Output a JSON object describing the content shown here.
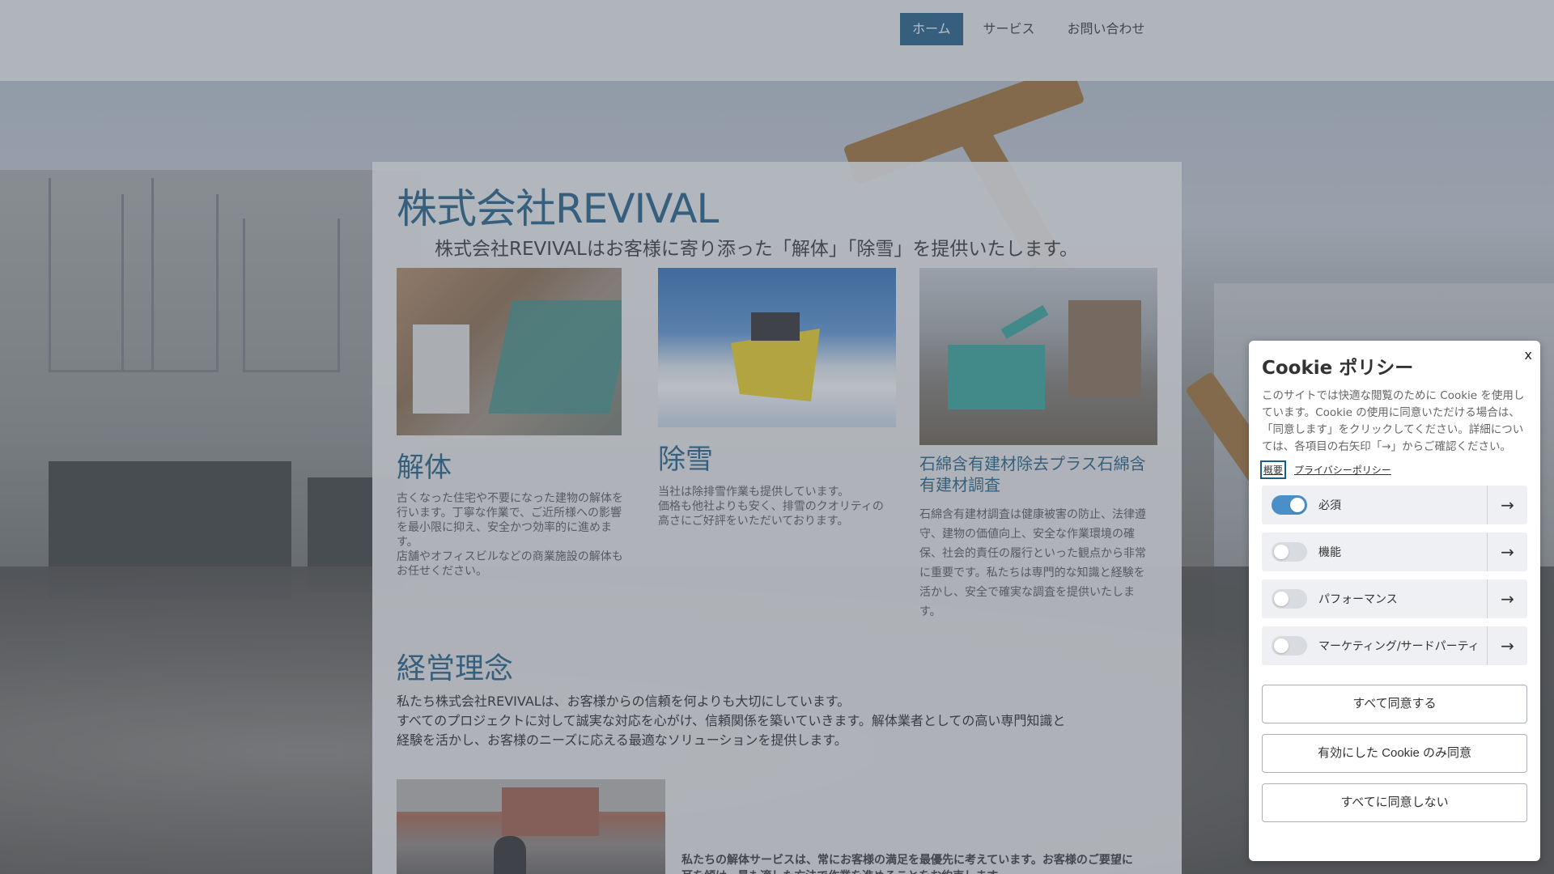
{
  "nav": {
    "items": [
      {
        "label": "ホーム",
        "active": true
      },
      {
        "label": "サービス",
        "active": false
      },
      {
        "label": "お問い合わせ",
        "active": false
      }
    ]
  },
  "hero": {
    "title": "株式会社REVIVAL",
    "lead": "株式会社REVIVALはお客様に寄り添った「解体」「除雪」を提供いたします。"
  },
  "services": [
    {
      "title": "解体",
      "text_lines": [
        " 古くなった住宅や不要になった建物の解体を",
        "行います。丁寧な作業で、ご近所様への影響",
        "を最小限に抑え、安全かつ効率的に進めま",
        "す。",
        "店舗やオフィスビルなどの商業施設の解体も",
        "お任せください。"
      ]
    },
    {
      "title": "除雪",
      "text_lines": [
        "当社は除排雪作業も提供しています。",
        "価格も他社よりも安く、排雪のクオリティの",
        "高さにご好評をいただいております。"
      ]
    },
    {
      "title": "石綿含有建材除去プラス石綿含有建材調査",
      "text_lines": [
        "石綿含有建材調査は健康被害の防止、法律遵",
        "守、建物の価値向上、安全な作業環境の確",
        "保、社会的責任の履行といった観点から非常",
        "に重要です。私たちは専門的な知識と経験を",
        "活かし、安全で確実な調査を提供いたしま",
        "す。"
      ]
    }
  ],
  "philosophy": {
    "title": "経営理念",
    "lines": [
      "私たち株式会社REVIVALは、お客様からの信頼を何よりも大切にしています。",
      "すべてのプロジェクトに対して誠実な対応を心がけ、信頼関係を築いていきます。解体業者としての高い専門知識と",
      "経験を活かし、お客様のニーズに応える最適なソリューションを提供します。"
    ]
  },
  "bottom": {
    "text": "私たちの解体サービスは、常にお客様の満足を最優先に考えています。お客様のご要望に耳を傾け、最も適した方法で作業を進めることをお約束します。"
  },
  "cookie": {
    "close_label": "x",
    "title": "Cookie ポリシー",
    "description": "このサイトでは快適な閲覧のために Cookie を使用しています。Cookie の使用に同意いただける場合は、「同意します」をクリックしてください。詳細については、各項目の右矢印「→」からご確認ください。",
    "links": {
      "overview": "概要",
      "privacy": "プライバシーポリシー"
    },
    "categories": [
      {
        "label": "必須",
        "enabled": true
      },
      {
        "label": "機能",
        "enabled": false
      },
      {
        "label": "パフォーマンス",
        "enabled": false
      },
      {
        "label": "マーケティング/サードパーティ",
        "enabled": false
      }
    ],
    "arrow_glyph": "→",
    "buttons": {
      "accept_all": "すべて同意する",
      "accept_selected": "有効にした Cookie のみ同意",
      "reject_all": "すべてに同意しない"
    }
  },
  "colors": {
    "brand": "#1d5c85",
    "toggle_on": "#4a8fc7"
  }
}
